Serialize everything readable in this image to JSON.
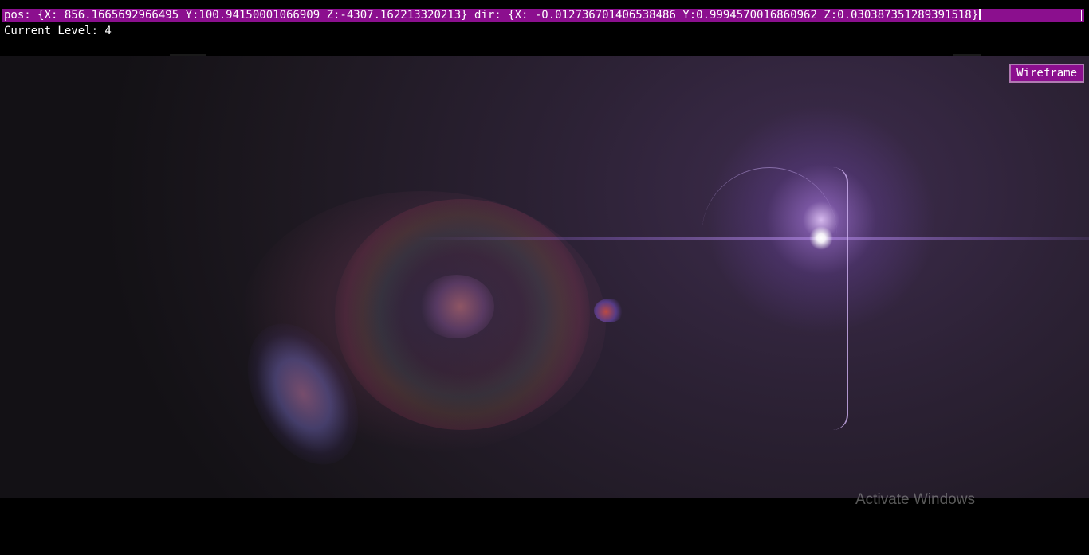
{
  "hud": {
    "position_text": "pos: {X: 856.1665692966495 Y:100.94150001066909 Z:-4307.162213320213} dir: {X: -0.012736701406538486 Y:0.9994570016860962 Z:0.030387351289391518}",
    "level_text": "Current Level: 4"
  },
  "controls": {
    "wireframe_label": "Wireframe"
  },
  "overlay": {
    "watermark_text": "Activate Windows"
  },
  "colors": {
    "accent": "#8b0f8e",
    "background": "#000000"
  }
}
